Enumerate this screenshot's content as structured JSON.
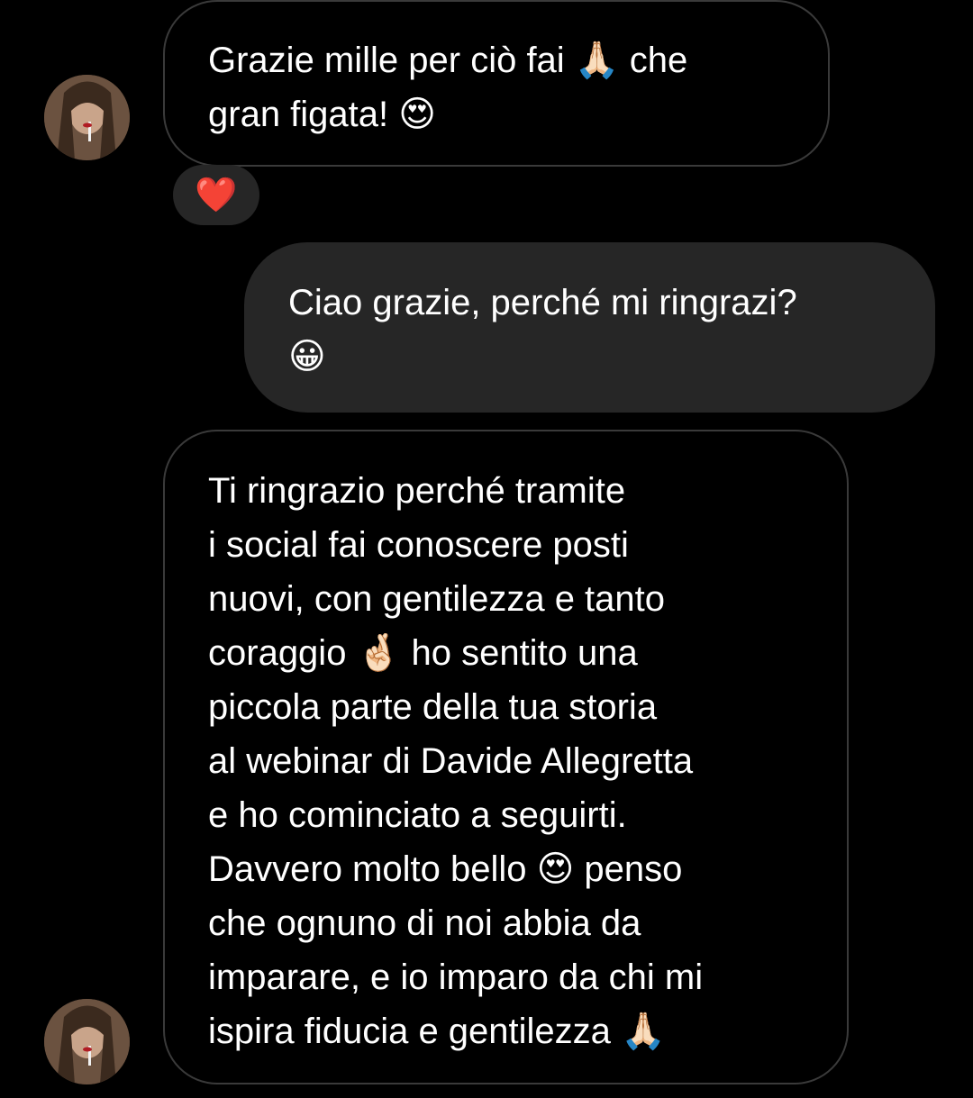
{
  "messages": [
    {
      "direction": "incoming",
      "lines": [
        "Grazie mille per ciò fai 🙏🏻 che",
        "gran figata! 😍"
      ]
    },
    {
      "direction": "outgoing",
      "lines": [
        "Ciao grazie, perché mi ringrazi?",
        "😀"
      ]
    },
    {
      "direction": "incoming",
      "lines": [
        "Ti ringrazio perché tramite",
        "i social fai conoscere posti",
        "nuovi, con gentilezza e tanto",
        "coraggio 🤞🏻 ho sentito una",
        "piccola parte della tua storia",
        "al webinar di Davide Allegretta",
        "e ho cominciato a seguirti.",
        "Davvero molto bello 😍 penso",
        "che ognuno di noi abbia da",
        "imparare, e io imparo da chi mi",
        "ispira fiducia e gentilezza 🙏🏻"
      ]
    }
  ],
  "reaction": {
    "emoji": "❤️",
    "color": "#e0203a"
  },
  "avatar": {
    "icon": "profile-photo-avatar"
  },
  "colors": {
    "background": "#000000",
    "outgoing_bubble": "#262626",
    "incoming_border": "#3a3a3a",
    "text": "#ffffff"
  }
}
